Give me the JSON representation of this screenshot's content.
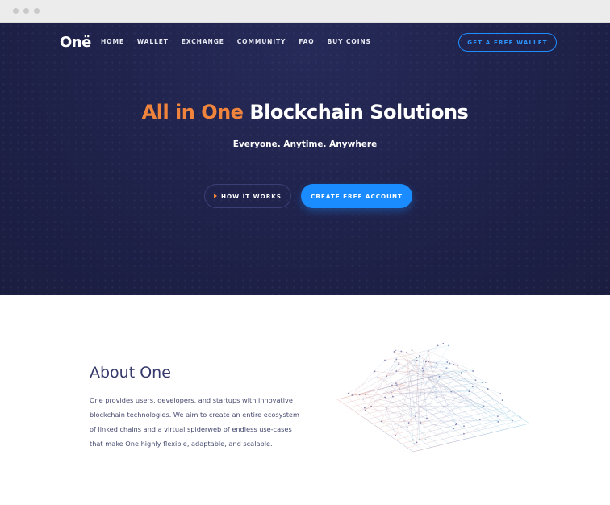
{
  "header": {
    "logo": "Onë",
    "nav": [
      "HOME",
      "WALLET",
      "EXCHANGE",
      "COMMUNITY",
      "FAQ",
      "BUY COINS"
    ],
    "wallet_button": "GET A FREE WALLET"
  },
  "hero": {
    "title_accent": "All in One",
    "title_rest": " Blockchain Solutions",
    "subtitle": "Everyone. Anytime. Anywhere",
    "how_button": "HOW IT WORKS",
    "how_icon": "play-icon",
    "create_button": "CREATE FREE ACCOUNT"
  },
  "about": {
    "title": "About One",
    "text": "One provides users, developers, and startups with innovative blockchain technologies. We aim to create an entire ecosystem of linked chains and a virtual spiderweb of endless use-cases that make One highly flexible, adaptable, and scalable."
  },
  "colors": {
    "hero_bg": "#1e2148",
    "accent_orange": "#f0843c",
    "accent_blue": "#1a8cff",
    "heading": "#34386a"
  }
}
